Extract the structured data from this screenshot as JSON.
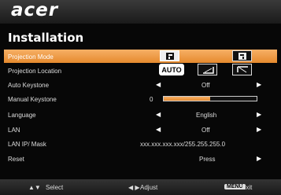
{
  "header": {
    "logo": "acer"
  },
  "menu": {
    "title": "Installation",
    "projection_mode": {
      "label": "Projection Mode"
    },
    "projection_location": {
      "label": "Projection Location",
      "auto_label": "AUTO"
    },
    "auto_keystone": {
      "label": "Auto Keystone",
      "value": "Off"
    },
    "manual_keystone": {
      "label": "Manual Keystone",
      "value": "0",
      "level": 0.5
    },
    "language": {
      "label": "Language",
      "value": "English"
    },
    "lan": {
      "label": "LAN",
      "value": "Off"
    },
    "lan_ip": {
      "label": "LAN IP/ Mask",
      "value": "xxx.xxx.xxx.xxx/255.255.255.0"
    },
    "reset": {
      "label": "Reset",
      "value": "Press"
    }
  },
  "footer": {
    "select": "Select",
    "adjust": "Adjust",
    "menu_key": "MENU",
    "exit": "Exit"
  },
  "colors": {
    "highlight": "#f0a050",
    "background": "#070707"
  }
}
